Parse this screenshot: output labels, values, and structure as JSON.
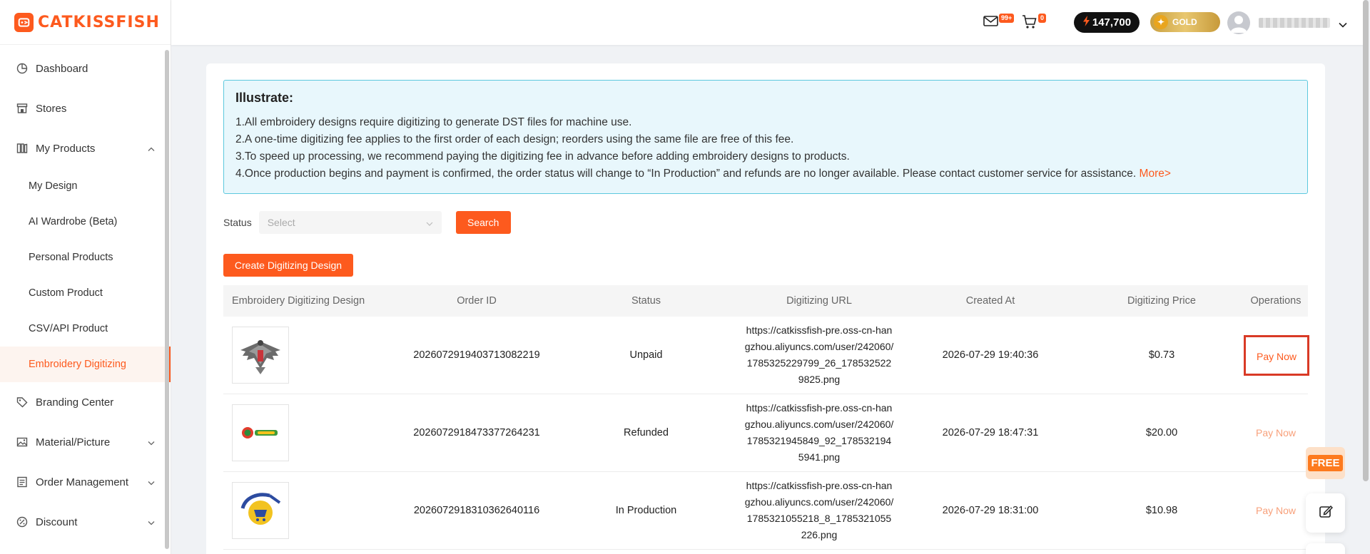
{
  "brand": {
    "name": "CATKISSFISH",
    "color": "#fd5a1e"
  },
  "header": {
    "mail_badge": "99+",
    "cart_badge": "0",
    "points": "147,700",
    "tier": "GOLD"
  },
  "sidebar": {
    "items": [
      {
        "label": "Dashboard",
        "icon": "pie-chart-icon"
      },
      {
        "label": "Stores",
        "icon": "store-icon"
      },
      {
        "label": "My Products",
        "icon": "products-icon",
        "expanded": true
      },
      {
        "label": "Branding Center",
        "icon": "tag-icon"
      },
      {
        "label": "Material/Picture",
        "icon": "image-icon"
      },
      {
        "label": "Order Management",
        "icon": "order-icon"
      },
      {
        "label": "Discount",
        "icon": "discount-icon"
      }
    ],
    "sub_items": [
      {
        "label": "My Design"
      },
      {
        "label": "AI Wardrobe (Beta)"
      },
      {
        "label": "Personal Products"
      },
      {
        "label": "Custom Product"
      },
      {
        "label": "CSV/API Product"
      },
      {
        "label": "Embroidery Digitizing",
        "active": true
      }
    ]
  },
  "notice": {
    "title": "Illustrate:",
    "lines": [
      "1.All embroidery designs require digitizing to generate DST files for machine use.",
      "2.A one-time digitizing fee applies to the first order of each design; reorders using the same file are free of this fee.",
      "3.To speed up processing, we recommend paying the digitizing fee in advance before adding embroidery designs to products.",
      "4.Once production begins and payment is confirmed, the order status will change to “In Production” and refunds are no longer available. Please contact customer service for assistance."
    ],
    "more": "More>"
  },
  "filter": {
    "status_label": "Status",
    "status_placeholder": "Select",
    "search_label": "Search",
    "create_label": "Create Digitizing Design"
  },
  "table": {
    "headers": [
      "Embroidery Digitizing Design",
      "Order ID",
      "Status",
      "Digitizing URL",
      "Created At",
      "Digitizing Price",
      "Operations"
    ],
    "rows": [
      {
        "order_id": "2026072919403713082219",
        "status": "Unpaid",
        "url": "https://catkissfish-pre.oss-cn-hangzhou.aliyuncs.com/user/242060/1785325229799_26_1785325229825.png",
        "created": "2026-07-29 19:40:36",
        "price": "$0.73",
        "op": "Pay Now"
      },
      {
        "order_id": "2026072918473377264231",
        "status": "Refunded",
        "url": "https://catkissfish-pre.oss-cn-hangzhou.aliyuncs.com/user/242060/1785321945849_92_1785321945941.png",
        "created": "2026-07-29 18:47:31",
        "price": "$20.00",
        "op": "Pay Now"
      },
      {
        "order_id": "2026072918310362640116",
        "status": "In Production",
        "url": "https://catkissfish-pre.oss-cn-hangzhou.aliyuncs.com/user/242060/1785321055218_8_1785321055226.png",
        "created": "2026-07-29 18:31:00",
        "price": "$10.98",
        "op": "Pay Now"
      }
    ]
  },
  "floating": {
    "free_label": "FREE"
  }
}
